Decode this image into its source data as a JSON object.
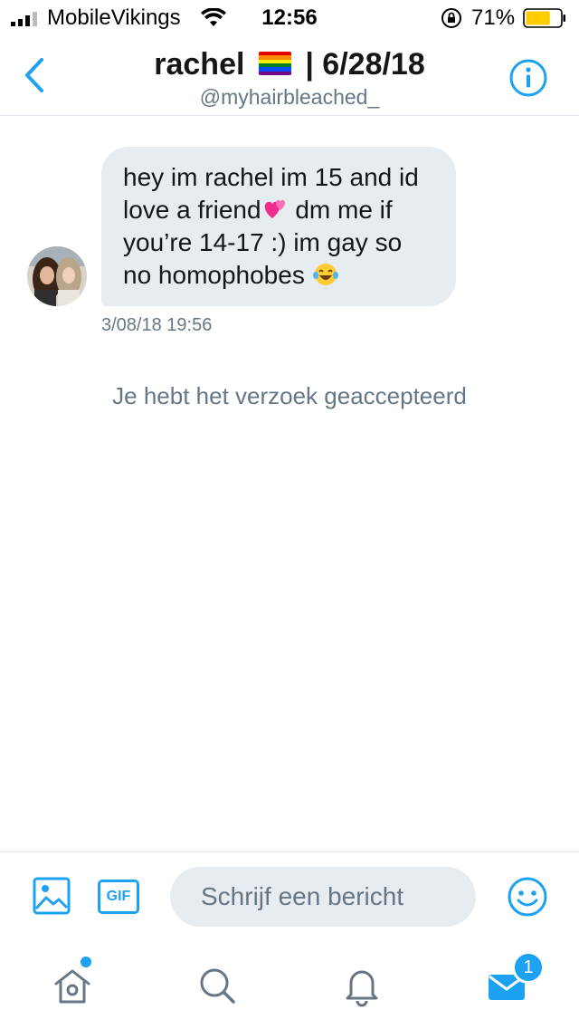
{
  "status_bar": {
    "carrier": "MobileVikings",
    "time": "12:56",
    "battery_percent": "71%",
    "battery_level": 0.71,
    "battery_color": "#ffcc00"
  },
  "header": {
    "title_name": "rachel",
    "title_flag": "rainbow-flag-emoji",
    "title_suffix": "| 6/28/18",
    "handle": "@myhairbleached_",
    "back_icon": "chevron-left-icon",
    "info_icon": "info-icon"
  },
  "conversation": {
    "message": {
      "line1": "hey im rachel im 15 and id",
      "line2a": "love a friend",
      "emoji1": "revolving-hearts-emoji",
      "line2b": " dm me if",
      "line3": "you’re 14-17 :) im gay so",
      "line4": "no homophobes ",
      "emoji2": "tears-of-joy-emoji",
      "timestamp": "3/08/18 19:56"
    },
    "system_message": "Je hebt het verzoek geaccepteerd"
  },
  "composer": {
    "media_icon": "image-icon",
    "gif_label": "GIF",
    "placeholder": "Schrijf een bericht",
    "emoji_icon": "smiley-icon"
  },
  "tabbar": {
    "items": [
      "home-icon",
      "search-icon",
      "bell-icon",
      "mail-icon"
    ],
    "messages_badge": "1"
  },
  "colors": {
    "accent": "#1da1f2",
    "bubble": "#e6ecf0",
    "secondary_text": "#657786"
  }
}
